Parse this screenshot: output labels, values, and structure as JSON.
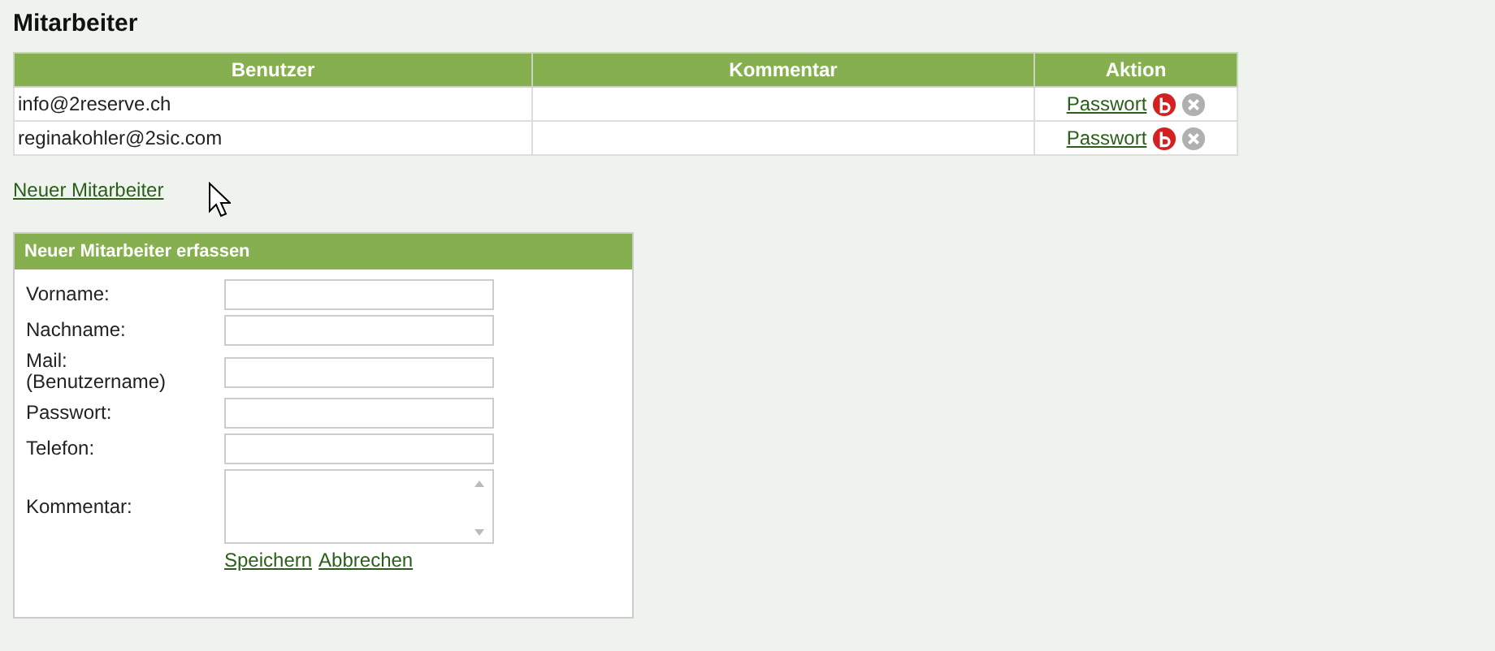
{
  "title": "Mitarbeiter",
  "table": {
    "columns": [
      "Benutzer",
      "Kommentar",
      "Aktion"
    ],
    "rows": [
      {
        "user": "info@2reserve.ch",
        "comment": "",
        "action_link": "Passwort"
      },
      {
        "user": "reginakohler@2sic.com",
        "comment": "",
        "action_link": "Passwort"
      }
    ]
  },
  "new_link": "Neuer Mitarbeiter",
  "form": {
    "title": "Neuer Mitarbeiter erfassen",
    "fields": [
      {
        "label": "Vorname:",
        "kind": "input"
      },
      {
        "label": "Nachname:",
        "kind": "input"
      },
      {
        "label": "Mail: (Benutzername)",
        "kind": "input"
      },
      {
        "label": "Passwort:",
        "kind": "input"
      },
      {
        "label": "Telefon:",
        "kind": "input"
      },
      {
        "label": "Kommentar:",
        "kind": "textarea"
      }
    ],
    "links": [
      "Speichern",
      "Abbrechen"
    ]
  }
}
